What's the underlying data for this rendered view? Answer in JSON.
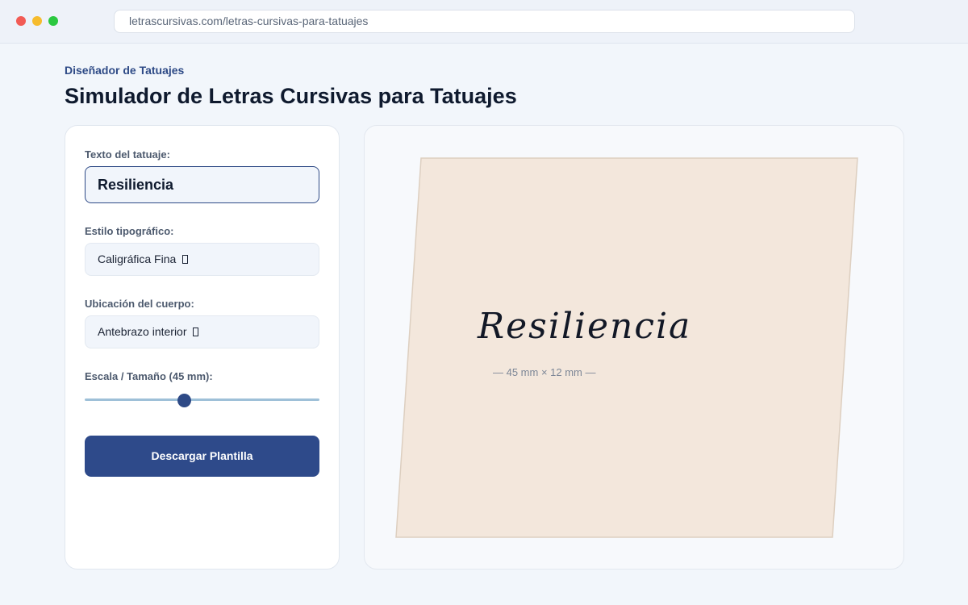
{
  "browser": {
    "url": "letrascursivas.com/letras-cursivas-para-tatuajes"
  },
  "page": {
    "kicker": "Diseñador de Tatuajes",
    "title": "Simulador de Letras Cursivas para Tatuajes"
  },
  "controls": {
    "text_label": "Texto del tatuaje:",
    "text_value": "Resiliencia",
    "font_label": "Estilo tipográfico:",
    "font_value": "Caligráfica Fina",
    "placement_label": "Ubicación del cuerpo:",
    "placement_value": "Antebrazo interior",
    "scale_label": "Escala / Tamaño (45 mm):",
    "scale_value_fraction": 0.42,
    "download_label": "Descargar Plantilla"
  },
  "preview": {
    "tattoo_text": "Resiliencia",
    "dimensions": "— 45 mm × 12 mm —"
  },
  "colors": {
    "accent": "#2e4a86",
    "skin": "#f3e7dc",
    "skin_edge": "#ddcfc0",
    "background": "#f2f6fb"
  },
  "icons": {
    "select_caret": "dropdown-caret-icon"
  }
}
